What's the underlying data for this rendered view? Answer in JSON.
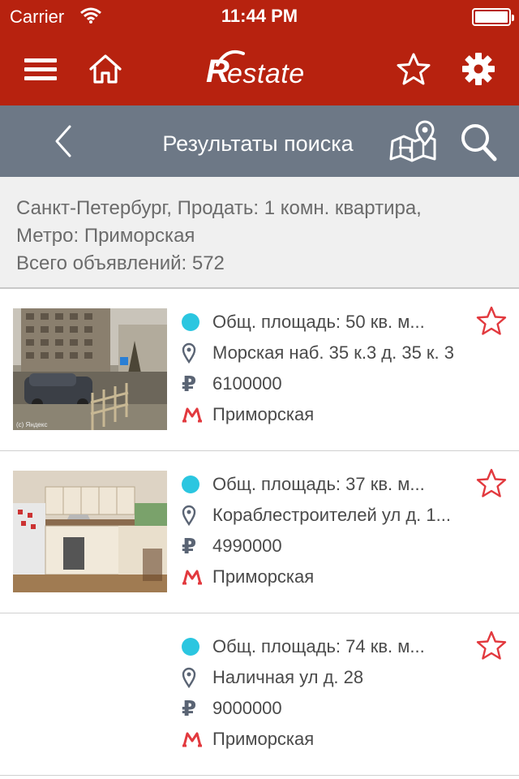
{
  "status_bar": {
    "carrier": "Carrier",
    "time": "11:44 PM"
  },
  "app_header": {
    "logo_letter": "R",
    "logo_text": "estate"
  },
  "nav": {
    "title": "Результаты поиска"
  },
  "summary": {
    "line1": "Санкт-Петербург, Продать: 1 комн. квартира,",
    "line2": "Метро: Приморская",
    "line3": "Всего объявлений: 572"
  },
  "listings": [
    {
      "area": "Общ. площадь: 50  кв. м...",
      "address": "Морская наб. 35 к.3  д. 35 к. 3",
      "price": "6100000",
      "metro": "Приморская",
      "watermark": "(c) Яндекс",
      "has_photo": true
    },
    {
      "area": "Общ. площадь: 37  кв. м...",
      "address": "Кораблестроителей ул  д. 1...",
      "price": "4990000",
      "metro": "Приморская",
      "has_photo": true
    },
    {
      "area": "Общ. площадь: 74  кв. м...",
      "address": "Наличная ул  д. 28",
      "price": "9000000",
      "metro": "Приморская",
      "has_photo": false
    }
  ],
  "icons": {
    "ruble": "₽"
  },
  "colors": {
    "header_red": "#b7220f",
    "nav_grey": "#6d7886",
    "status_dot": "#2bc6e0",
    "favorite_red": "#e2393e",
    "metro_red": "#e2393e"
  }
}
